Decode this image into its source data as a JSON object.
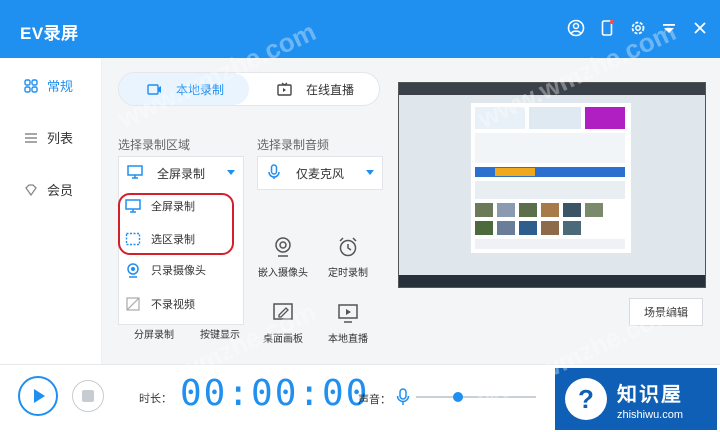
{
  "app": {
    "title": "EV录屏"
  },
  "colors": {
    "accent": "#1f8ff0",
    "highlight": "#d21f2b"
  },
  "titlebar_icons": [
    "user-icon",
    "phone-icon",
    "settings-icon",
    "menu-icon",
    "close-icon"
  ],
  "sidebar": {
    "items": [
      {
        "label": "常规",
        "icon": "grid-icon",
        "active": true
      },
      {
        "label": "列表",
        "icon": "list-icon",
        "active": false
      },
      {
        "label": "会员",
        "icon": "diamond-icon",
        "active": false
      }
    ]
  },
  "mode_tabs": [
    {
      "label": "本地录制",
      "icon": "record-icon"
    },
    {
      "label": "在线直播",
      "icon": "tv-icon"
    }
  ],
  "record_area": {
    "label": "选择录制区域",
    "selected": "全屏录制",
    "options": [
      "全屏录制",
      "选区录制",
      "只录摄像头",
      "不录视频"
    ]
  },
  "audio": {
    "label": "选择录制音频",
    "selected": "仅麦克风"
  },
  "tools": [
    {
      "label": "嵌入摄像头",
      "icon": "webcam-icon"
    },
    {
      "label": "定时录制",
      "icon": "alarm-icon"
    },
    {
      "label": "桌面画板",
      "icon": "pen-icon"
    },
    {
      "label": "本地直播",
      "icon": "play-screen-icon"
    }
  ],
  "bottom_links": {
    "split": "分屏录制",
    "keys": "按键显示"
  },
  "scene_button": "场景编辑",
  "bottom": {
    "duration_label": "时长：",
    "timer": "00:00:00",
    "volume_label": "声音：",
    "volume_level": 0.35
  },
  "watermark": {
    "title": "知识屋",
    "subtitle": "zhishiwu.com",
    "overlay": "www.wmzhe.com"
  }
}
